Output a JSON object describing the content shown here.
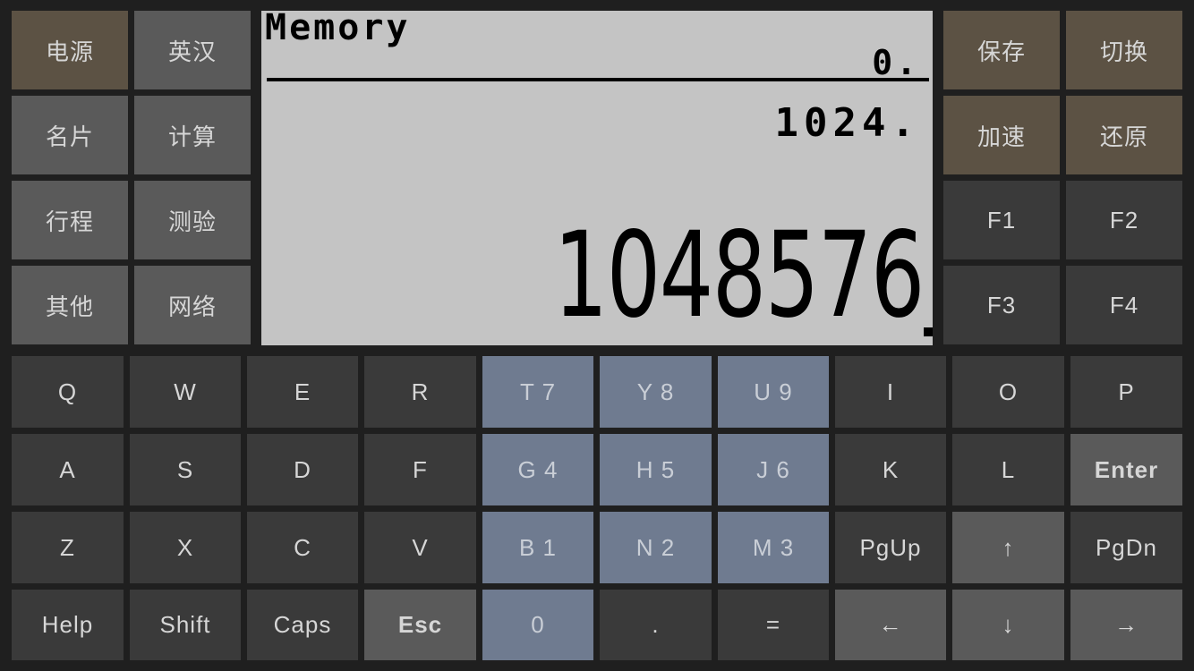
{
  "left_panel": {
    "keys": [
      "电源",
      "英汉",
      "名片",
      "计算",
      "行程",
      "测验",
      "其他",
      "网络"
    ]
  },
  "right_panel": {
    "keys": [
      "保存",
      "切换",
      "加速",
      "还原",
      "F1",
      "F2",
      "F3",
      "F4"
    ]
  },
  "lcd": {
    "title": "Memory",
    "memory_value": "0.",
    "line1": "1024.",
    "main_value": "1048576"
  },
  "keyboard": {
    "row1": [
      "Q",
      "W",
      "E",
      "R",
      "T 7",
      "Y 8",
      "U 9",
      "I",
      "O",
      "P"
    ],
    "row2": [
      "A",
      "S",
      "D",
      "F",
      "G 4",
      "H 5",
      "J 6",
      "K",
      "L",
      "Enter"
    ],
    "row3": [
      "Z",
      "X",
      "C",
      "V",
      "B 1",
      "N 2",
      "M 3",
      "PgUp",
      "↑",
      "PgDn"
    ],
    "row4": [
      "Help",
      "Shift",
      "Caps",
      "Esc",
      "0",
      ".",
      "=",
      "←",
      "↓",
      "→"
    ]
  },
  "colors": {
    "background": "#1f1f1f",
    "function_key_brown": "#5c5244",
    "app_key_gray": "#5a5a5a",
    "letter_key_dark": "#3a3a3a",
    "number_key_blue": "#6f7b90",
    "lcd_background": "#c4c4c4"
  }
}
